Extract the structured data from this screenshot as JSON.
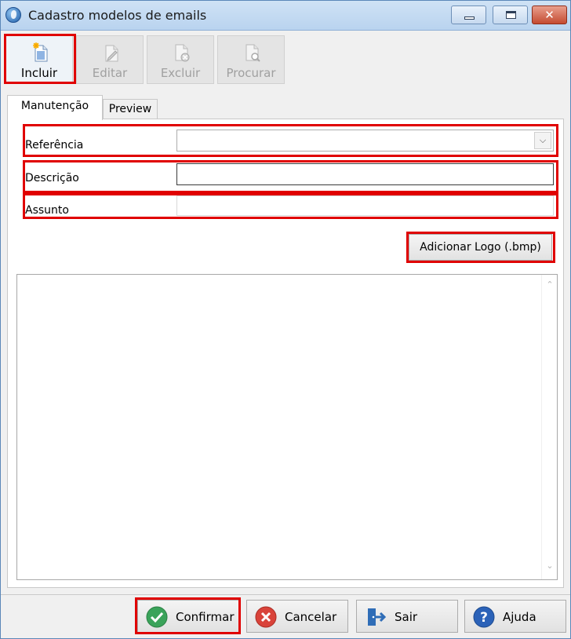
{
  "window": {
    "title": "Cadastro modelos de emails"
  },
  "title_buttons": {
    "minimize_icon": "minimize-icon",
    "maximize_icon": "maximize-icon",
    "close_glyph": "✕"
  },
  "toolbar": {
    "incluir": {
      "label": "Incluir",
      "enabled": true,
      "icon": "new-document-icon"
    },
    "editar": {
      "label": "Editar",
      "enabled": false,
      "icon": "edit-document-icon"
    },
    "excluir": {
      "label": "Excluir",
      "enabled": false,
      "icon": "delete-document-icon"
    },
    "procurar": {
      "label": "Procurar",
      "enabled": false,
      "icon": "search-document-icon"
    }
  },
  "tabs": [
    {
      "label": "Manutenção",
      "active": true
    },
    {
      "label": "Preview",
      "active": false
    }
  ],
  "form": {
    "referencia_label": "Referência",
    "referencia_value": "",
    "descricao_label": "Descrição",
    "descricao_value": "",
    "assunto_label": "Assunto",
    "assunto_value": "",
    "add_logo_button": "Adicionar Logo (.bmp)"
  },
  "editor": {
    "content": ""
  },
  "bottom_buttons": {
    "confirmar": "Confirmar",
    "cancelar": "Cancelar",
    "sair": "Sair",
    "ajuda": "Ajuda"
  },
  "colors": {
    "highlight": "#e00000",
    "confirm_green": "#3aa35a",
    "cancel_red": "#d9433a",
    "exit_blue": "#2f6db7",
    "help_blue": "#2b62b8"
  }
}
